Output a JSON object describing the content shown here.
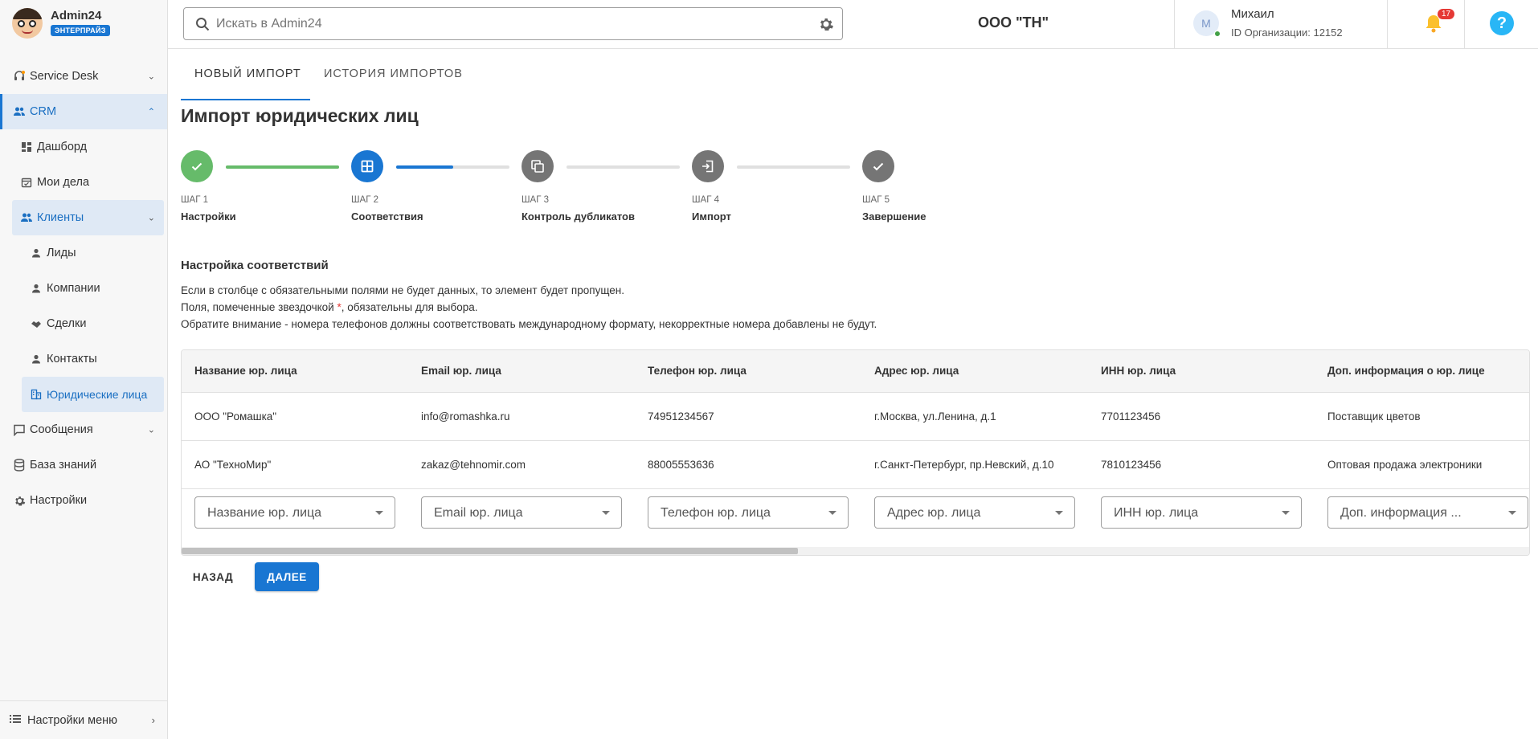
{
  "brand": {
    "name": "Admin24",
    "badge": "ЭНТЕРПРАЙЗ"
  },
  "sidebar": {
    "items": [
      {
        "label": "Service Desk",
        "icon": "headset-icon"
      },
      {
        "label": "CRM",
        "icon": "people-icon"
      },
      {
        "label": "Дашборд",
        "icon": "dashboard-icon"
      },
      {
        "label": "Мои дела",
        "icon": "calendar-check-icon"
      },
      {
        "label": "Клиенты",
        "icon": "people-icon"
      },
      {
        "label": "Лиды",
        "icon": "person-icon"
      },
      {
        "label": "Компании",
        "icon": "person-icon"
      },
      {
        "label": "Сделки",
        "icon": "handshake-icon"
      },
      {
        "label": "Контакты",
        "icon": "person-icon"
      },
      {
        "label": "Юридические лица",
        "icon": "building-icon"
      },
      {
        "label": "Сообщения",
        "icon": "chat-icon"
      },
      {
        "label": "База знаний",
        "icon": "database-icon"
      },
      {
        "label": "Настройки",
        "icon": "gear-icon"
      }
    ],
    "bottom_label": "Настройки меню"
  },
  "header": {
    "search_placeholder": "Искать в Admin24",
    "org_title": "ООО \"ТН\"",
    "user_initial": "М",
    "user_name": "Михаил",
    "user_org": "ID Организации: 12152",
    "notifications_count": "17",
    "help_label": "?"
  },
  "tabs": [
    {
      "label": "НОВЫЙ ИМПОРТ",
      "active": true
    },
    {
      "label": "ИСТОРИЯ ИМПОРТОВ",
      "active": false
    }
  ],
  "page_title": "Импорт юридических лиц",
  "steps": [
    {
      "num": "ШАГ 1",
      "label": "Настройки",
      "state": "done",
      "progress_after": 1.0
    },
    {
      "num": "ШАГ 2",
      "label": "Соответствия",
      "state": "active",
      "progress_after": 0.5
    },
    {
      "num": "ШАГ 3",
      "label": "Контроль дубликатов",
      "state": "pending",
      "progress_after": 0.0
    },
    {
      "num": "ШАГ 4",
      "label": "Импорт",
      "state": "pending",
      "progress_after": 0.0
    },
    {
      "num": "ШАГ 5",
      "label": "Завершение",
      "state": "pending"
    }
  ],
  "section_title": "Настройка соответствий",
  "info": {
    "line1": "Если в столбце с обязательными полями не будет данных, то элемент будет пропущен.",
    "line2_a": "Поля, помеченные звездочкой ",
    "line2_star": "*",
    "line2_b": ", обязательны для выбора.",
    "line3": "Обратите внимание - номера телефонов должны соответствовать международному формату, некорректные номера добавлены не будут."
  },
  "table": {
    "headers": [
      "Название юр. лица",
      "Email юр. лица",
      "Телефон юр. лица",
      "Адрес юр. лица",
      "ИНН юр. лица",
      "Доп. информация о юр. лице"
    ],
    "rows": [
      [
        "ООО \"Ромашка\"",
        "info@romashka.ru",
        "74951234567",
        "г.Москва, ул.Ленина, д.1",
        "7701123456",
        "Поставщик цветов"
      ],
      [
        "АО \"ТехноМир\"",
        "zakaz@tehnomir.com",
        "88005553636",
        "г.Санкт-Петербург, пр.Невский, д.10",
        "7810123456",
        "Оптовая продажа электроники"
      ]
    ],
    "selects": [
      "Название юр. лица",
      "Email юр. лица",
      "Телефон юр. лица",
      "Адрес юр. лица",
      "ИНН юр. лица",
      "Доп. информация ..."
    ]
  },
  "buttons": {
    "back": "НАЗАД",
    "next": "ДАЛЕЕ"
  },
  "colors": {
    "accent": "#1976d2",
    "done": "#66bb6a",
    "pending": "#757575"
  }
}
